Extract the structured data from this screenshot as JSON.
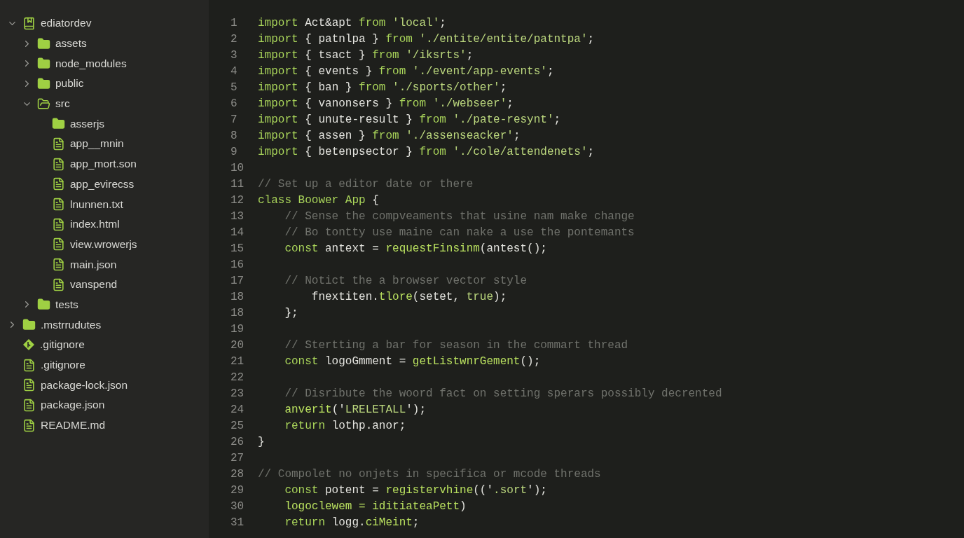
{
  "sidebar": {
    "tree": [
      {
        "label": "ediatordev",
        "kind": "repo",
        "expanded": true,
        "children": [
          {
            "label": "assets",
            "kind": "folder",
            "expanded": false
          },
          {
            "label": "node_modules",
            "kind": "folder",
            "expanded": false
          },
          {
            "label": "public",
            "kind": "folder",
            "expanded": false
          },
          {
            "label": "src",
            "kind": "folder",
            "expanded": true,
            "children": [
              {
                "label": "asserjs",
                "kind": "folder"
              },
              {
                "label": "app__mnin",
                "kind": "file"
              },
              {
                "label": "app_mort.son",
                "kind": "file"
              },
              {
                "label": "app_evirecss",
                "kind": "file"
              },
              {
                "label": "lnunnen.txt",
                "kind": "file"
              },
              {
                "label": "index.html",
                "kind": "file"
              },
              {
                "label": "view.wrowerjs",
                "kind": "file"
              },
              {
                "label": "main.json",
                "kind": "file"
              },
              {
                "label": "vanspend",
                "kind": "file"
              }
            ]
          },
          {
            "label": "tests",
            "kind": "folder",
            "expanded": false
          }
        ]
      },
      {
        "label": ".mstrrudutes",
        "kind": "folder",
        "expanded": false
      },
      {
        "label": ".gitignore",
        "kind": "git"
      },
      {
        "label": ".gitignore",
        "kind": "file"
      },
      {
        "label": "package-lock.json",
        "kind": "file"
      },
      {
        "label": "package.json",
        "kind": "file"
      },
      {
        "label": "README.md",
        "kind": "file"
      }
    ]
  },
  "editor": {
    "lines": [
      {
        "number": "1",
        "tokens": [
          {
            "text": "import ",
            "kind": "keyword"
          },
          {
            "text": "Act&apt ",
            "kind": "name"
          },
          {
            "text": "from ",
            "kind": "keyword"
          },
          {
            "text": "'local'",
            "kind": "string"
          },
          {
            "text": ";",
            "kind": "name"
          }
        ]
      },
      {
        "number": "2",
        "tokens": [
          {
            "text": "import ",
            "kind": "keyword"
          },
          {
            "text": "{ patnlpa } ",
            "kind": "name"
          },
          {
            "text": "from ",
            "kind": "keyword"
          },
          {
            "text": "'./entite/entite/patntpa'",
            "kind": "string"
          },
          {
            "text": ";",
            "kind": "name"
          }
        ]
      },
      {
        "number": "3",
        "tokens": [
          {
            "text": "import ",
            "kind": "keyword"
          },
          {
            "text": "{ tsact } ",
            "kind": "name"
          },
          {
            "text": "from ",
            "kind": "keyword"
          },
          {
            "text": "'/iksrts'",
            "kind": "string"
          },
          {
            "text": ";",
            "kind": "name"
          }
        ]
      },
      {
        "number": "4",
        "tokens": [
          {
            "text": "import ",
            "kind": "keyword"
          },
          {
            "text": "{ events } ",
            "kind": "name"
          },
          {
            "text": "from ",
            "kind": "keyword"
          },
          {
            "text": "'./event/app-events'",
            "kind": "string"
          },
          {
            "text": ";",
            "kind": "name"
          }
        ]
      },
      {
        "number": "5",
        "tokens": [
          {
            "text": "import ",
            "kind": "keyword"
          },
          {
            "text": "{ ban } ",
            "kind": "name"
          },
          {
            "text": "from ",
            "kind": "keyword"
          },
          {
            "text": "'./sports/other'",
            "kind": "string"
          },
          {
            "text": ";",
            "kind": "name"
          }
        ]
      },
      {
        "number": "6",
        "tokens": [
          {
            "text": "import ",
            "kind": "keyword"
          },
          {
            "text": "{ vanonsers } ",
            "kind": "name"
          },
          {
            "text": "from ",
            "kind": "keyword"
          },
          {
            "text": "'./webseer'",
            "kind": "string"
          },
          {
            "text": ";",
            "kind": "name"
          }
        ]
      },
      {
        "number": "7",
        "tokens": [
          {
            "text": "import ",
            "kind": "keyword"
          },
          {
            "text": "{ unute-result } ",
            "kind": "name"
          },
          {
            "text": "from ",
            "kind": "keyword"
          },
          {
            "text": "'./pate-resynt'",
            "kind": "string"
          },
          {
            "text": ";",
            "kind": "name"
          }
        ]
      },
      {
        "number": "8",
        "tokens": [
          {
            "text": "import ",
            "kind": "keyword"
          },
          {
            "text": "{ assen } ",
            "kind": "name"
          },
          {
            "text": "from ",
            "kind": "keyword"
          },
          {
            "text": "'./assenseacker'",
            "kind": "string"
          },
          {
            "text": ";",
            "kind": "name"
          }
        ]
      },
      {
        "number": "9",
        "tokens": [
          {
            "text": "import ",
            "kind": "keyword"
          },
          {
            "text": "{ betenpsector } ",
            "kind": "name"
          },
          {
            "text": "from ",
            "kind": "keyword"
          },
          {
            "text": "'./cole/attendenets'",
            "kind": "string"
          },
          {
            "text": ";",
            "kind": "name"
          }
        ]
      },
      {
        "number": "10"
      },
      {
        "number": "11",
        "tokens": [
          {
            "text": "// Set up a editor date or there",
            "kind": "comment"
          }
        ]
      },
      {
        "number": "12",
        "tokens": [
          {
            "text": "class Boower App ",
            "kind": "keyword"
          },
          {
            "text": "{",
            "kind": "name"
          }
        ]
      },
      {
        "number": "13",
        "tokens": [
          {
            "text": "    // Sense the compveaments that usine nam make change",
            "kind": "comment"
          }
        ]
      },
      {
        "number": "14",
        "tokens": [
          {
            "text": "    // Bo tontty use maine can nake a use the pontemants",
            "kind": "comment"
          }
        ]
      },
      {
        "number": "15",
        "tokens": [
          {
            "text": "    const ",
            "kind": "keyword"
          },
          {
            "text": "antext = ",
            "kind": "name"
          },
          {
            "text": "requestFinsinm",
            "kind": "function"
          },
          {
            "text": "(antest();",
            "kind": "name"
          }
        ]
      },
      {
        "number": "16"
      },
      {
        "number": "17",
        "tokens": [
          {
            "text": "    // Notict the a browser vector style",
            "kind": "comment"
          }
        ]
      },
      {
        "number": "18",
        "tokens": [
          {
            "text": "        fnextiten.",
            "kind": "name"
          },
          {
            "text": "tlore",
            "kind": "function"
          },
          {
            "text": "(setet, ",
            "kind": "name"
          },
          {
            "text": "true",
            "kind": "string"
          },
          {
            "text": ");",
            "kind": "name"
          }
        ]
      },
      {
        "number": "18",
        "tokens": [
          {
            "text": "    };",
            "kind": "name"
          }
        ]
      },
      {
        "number": "19"
      },
      {
        "number": "20",
        "tokens": [
          {
            "text": "    // Stertting a bar for season in the commart thread",
            "kind": "comment"
          }
        ]
      },
      {
        "number": "21",
        "tokens": [
          {
            "text": "    const ",
            "kind": "keyword"
          },
          {
            "text": "logoGmment = ",
            "kind": "name"
          },
          {
            "text": "getListwnrGement",
            "kind": "function"
          },
          {
            "text": "();",
            "kind": "name"
          }
        ]
      },
      {
        "number": "22"
      },
      {
        "number": "23",
        "tokens": [
          {
            "text": "    // Disribute the woord fact on setting sperars possibly decrented",
            "kind": "comment"
          }
        ]
      },
      {
        "number": "24",
        "tokens": [
          {
            "text": "    anverit",
            "kind": "function"
          },
          {
            "text": "('",
            "kind": "name"
          },
          {
            "text": "LRELETALL",
            "kind": "string"
          },
          {
            "text": "');",
            "kind": "name"
          }
        ]
      },
      {
        "number": "25",
        "tokens": [
          {
            "text": "    return ",
            "kind": "keyword"
          },
          {
            "text": "lothp.anor;",
            "kind": "name"
          }
        ]
      },
      {
        "number": "26",
        "tokens": [
          {
            "text": "}",
            "kind": "name"
          }
        ]
      },
      {
        "number": "27"
      },
      {
        "number": "28",
        "tokens": [
          {
            "text": "// Compolet no onjets in specifica or mcode threads",
            "kind": "comment"
          }
        ]
      },
      {
        "number": "29",
        "tokens": [
          {
            "text": "    const ",
            "kind": "keyword"
          },
          {
            "text": "potent = ",
            "kind": "name"
          },
          {
            "text": "registervhine",
            "kind": "function"
          },
          {
            "text": "(('",
            "kind": "name"
          },
          {
            "text": ".sort",
            "kind": "string"
          },
          {
            "text": "');",
            "kind": "name"
          }
        ]
      },
      {
        "number": "30",
        "tokens": [
          {
            "text": "    logoclewem = ",
            "kind": "function"
          },
          {
            "text": "iditiateaPett",
            "kind": "function"
          },
          {
            "text": ")",
            "kind": "name"
          }
        ]
      },
      {
        "number": "31",
        "tokens": [
          {
            "text": "    return ",
            "kind": "keyword"
          },
          {
            "text": "logg.",
            "kind": "name"
          },
          {
            "text": "ciMeint",
            "kind": "function"
          },
          {
            "text": ";",
            "kind": "name"
          }
        ]
      }
    ]
  }
}
